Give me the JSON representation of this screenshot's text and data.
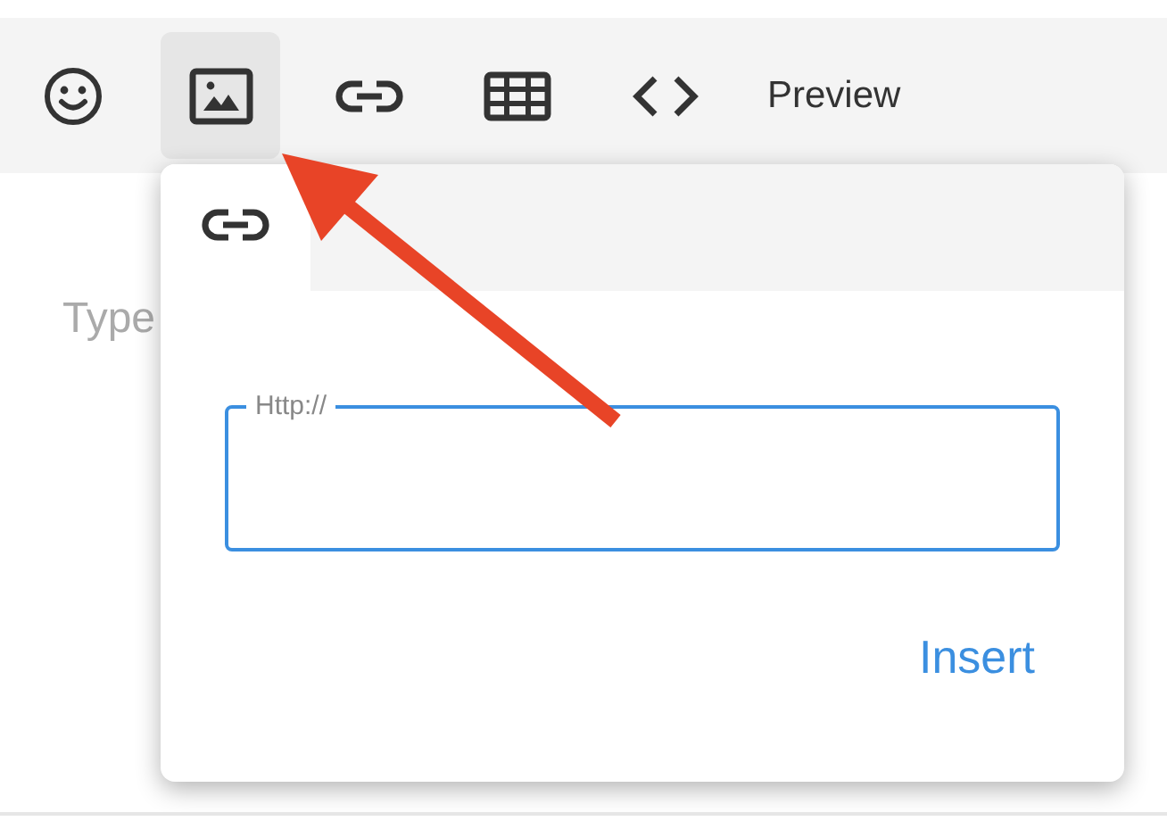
{
  "toolbar": {
    "items": [
      {
        "kind": "emoji",
        "selected": false
      },
      {
        "kind": "image",
        "selected": true
      },
      {
        "kind": "link",
        "selected": false
      },
      {
        "kind": "table",
        "selected": false
      },
      {
        "kind": "code",
        "selected": false
      },
      {
        "kind": "text",
        "label": "Preview",
        "selected": false
      }
    ]
  },
  "editor": {
    "placeholder": "Type"
  },
  "popup": {
    "tabs": [
      {
        "kind": "link",
        "selected": true
      }
    ],
    "field": {
      "label": "Http://"
    },
    "button": "Insert"
  },
  "annotation": {
    "kind": "arrow"
  }
}
